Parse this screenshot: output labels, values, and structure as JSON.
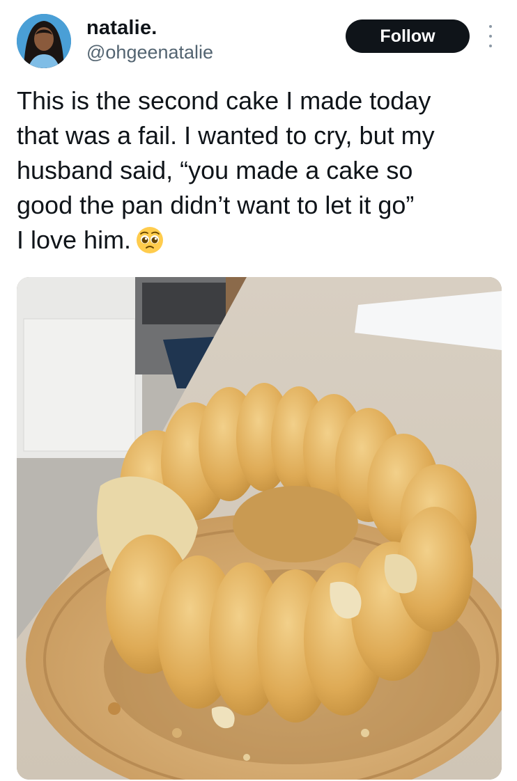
{
  "tweet": {
    "author": {
      "display_name": "natalie.",
      "handle": "@ohgeenatalie",
      "avatar_icon": "profile-photo"
    },
    "follow_label": "Follow",
    "more_icon": "vertical-ellipsis-icon",
    "text_lines": [
      "This is the second cake I made today",
      "that was a fail. I wanted to cry, but my",
      "husband said, “you made a cake so",
      "good the pan didn’t want to let it go”",
      "I love him."
    ],
    "emoji": "pleading-face-emoji",
    "media": {
      "type": "photo",
      "subject": "broken bundt cake on wooden board"
    }
  },
  "colors": {
    "text": "#0f1419",
    "secondary_text": "#536471",
    "button_bg": "#0f1419",
    "button_text": "#ffffff"
  }
}
